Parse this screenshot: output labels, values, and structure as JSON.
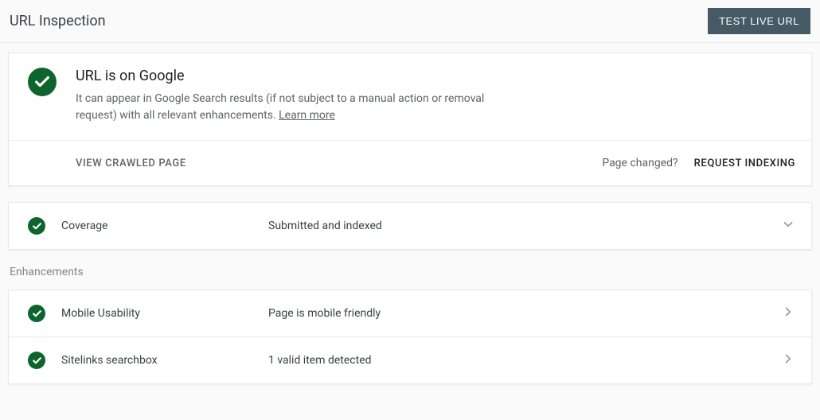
{
  "header": {
    "title": "URL Inspection",
    "test_button": "TEST LIVE URL"
  },
  "status": {
    "title": "URL is on Google",
    "description_before_link": "It can appear in Google Search results (if not subject to a manual action or removal request) with all relevant enhancements. ",
    "learn_more": "Learn more",
    "view_crawled": "VIEW CRAWLED PAGE",
    "page_changed": "Page changed?",
    "request_indexing": "REQUEST INDEXING"
  },
  "coverage": {
    "label": "Coverage",
    "value": "Submitted and indexed"
  },
  "enhancements_label": "Enhancements",
  "enhancements": [
    {
      "label": "Mobile Usability",
      "value": "Page is mobile friendly"
    },
    {
      "label": "Sitelinks searchbox",
      "value": "1 valid item detected"
    }
  ]
}
